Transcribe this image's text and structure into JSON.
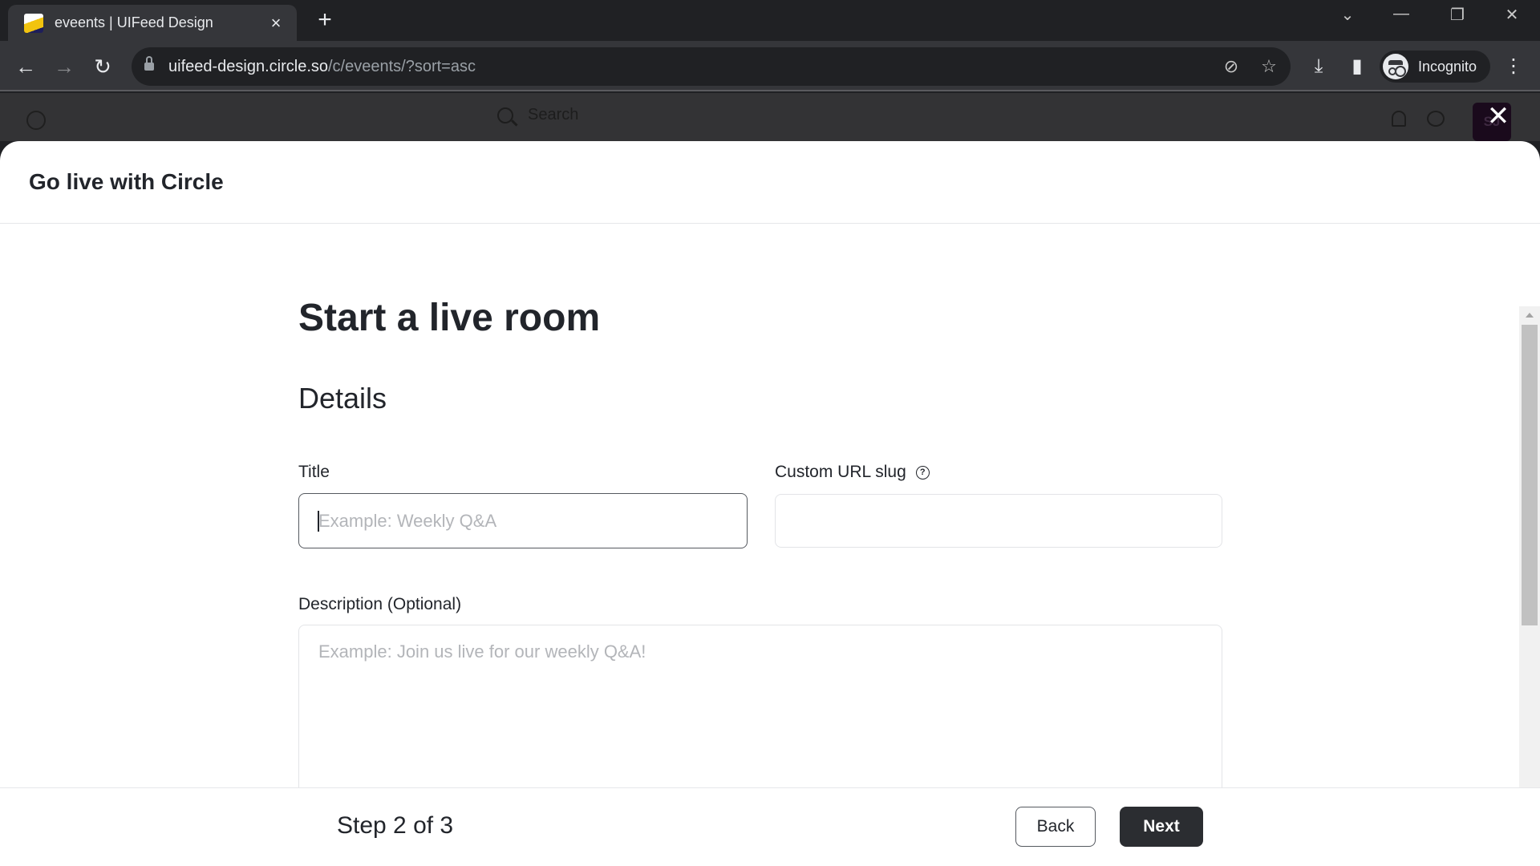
{
  "browser": {
    "tab_title": "eveents | UIFeed Design",
    "tab_close_icon": "×",
    "new_tab_icon": "+",
    "url_host": "uifeed-design.circle.so",
    "url_path": "/c/eveents/?sort=asc",
    "profile_label": "Incognito",
    "icons": {
      "back": "←",
      "forward": "→",
      "reload": "↻",
      "tracking_protection": "⊘",
      "bookmark": "☆",
      "download": "⤓",
      "side_panel": "▮",
      "menu": "⋮",
      "tab_search": "⌄",
      "minimize": "—",
      "restore": "❐",
      "close": "✕"
    }
  },
  "app": {
    "search_placeholder": "Search",
    "user_initials": "SJ",
    "modal_close_icon": "✕"
  },
  "modal": {
    "title": "Go live with Circle",
    "heading": "Start a live room",
    "section": "Details",
    "fields": {
      "title": {
        "label": "Title",
        "placeholder": "Example: Weekly Q&A",
        "value": ""
      },
      "slug": {
        "label": "Custom URL slug",
        "help_icon": "?",
        "value": ""
      },
      "description": {
        "label": "Description (Optional)",
        "placeholder": "Example: Join us live for our weekly Q&A!",
        "value": ""
      }
    },
    "footer": {
      "step_text": "Step 2 of 3",
      "back_label": "Back",
      "next_label": "Next"
    },
    "cursor_glyph": "I"
  }
}
